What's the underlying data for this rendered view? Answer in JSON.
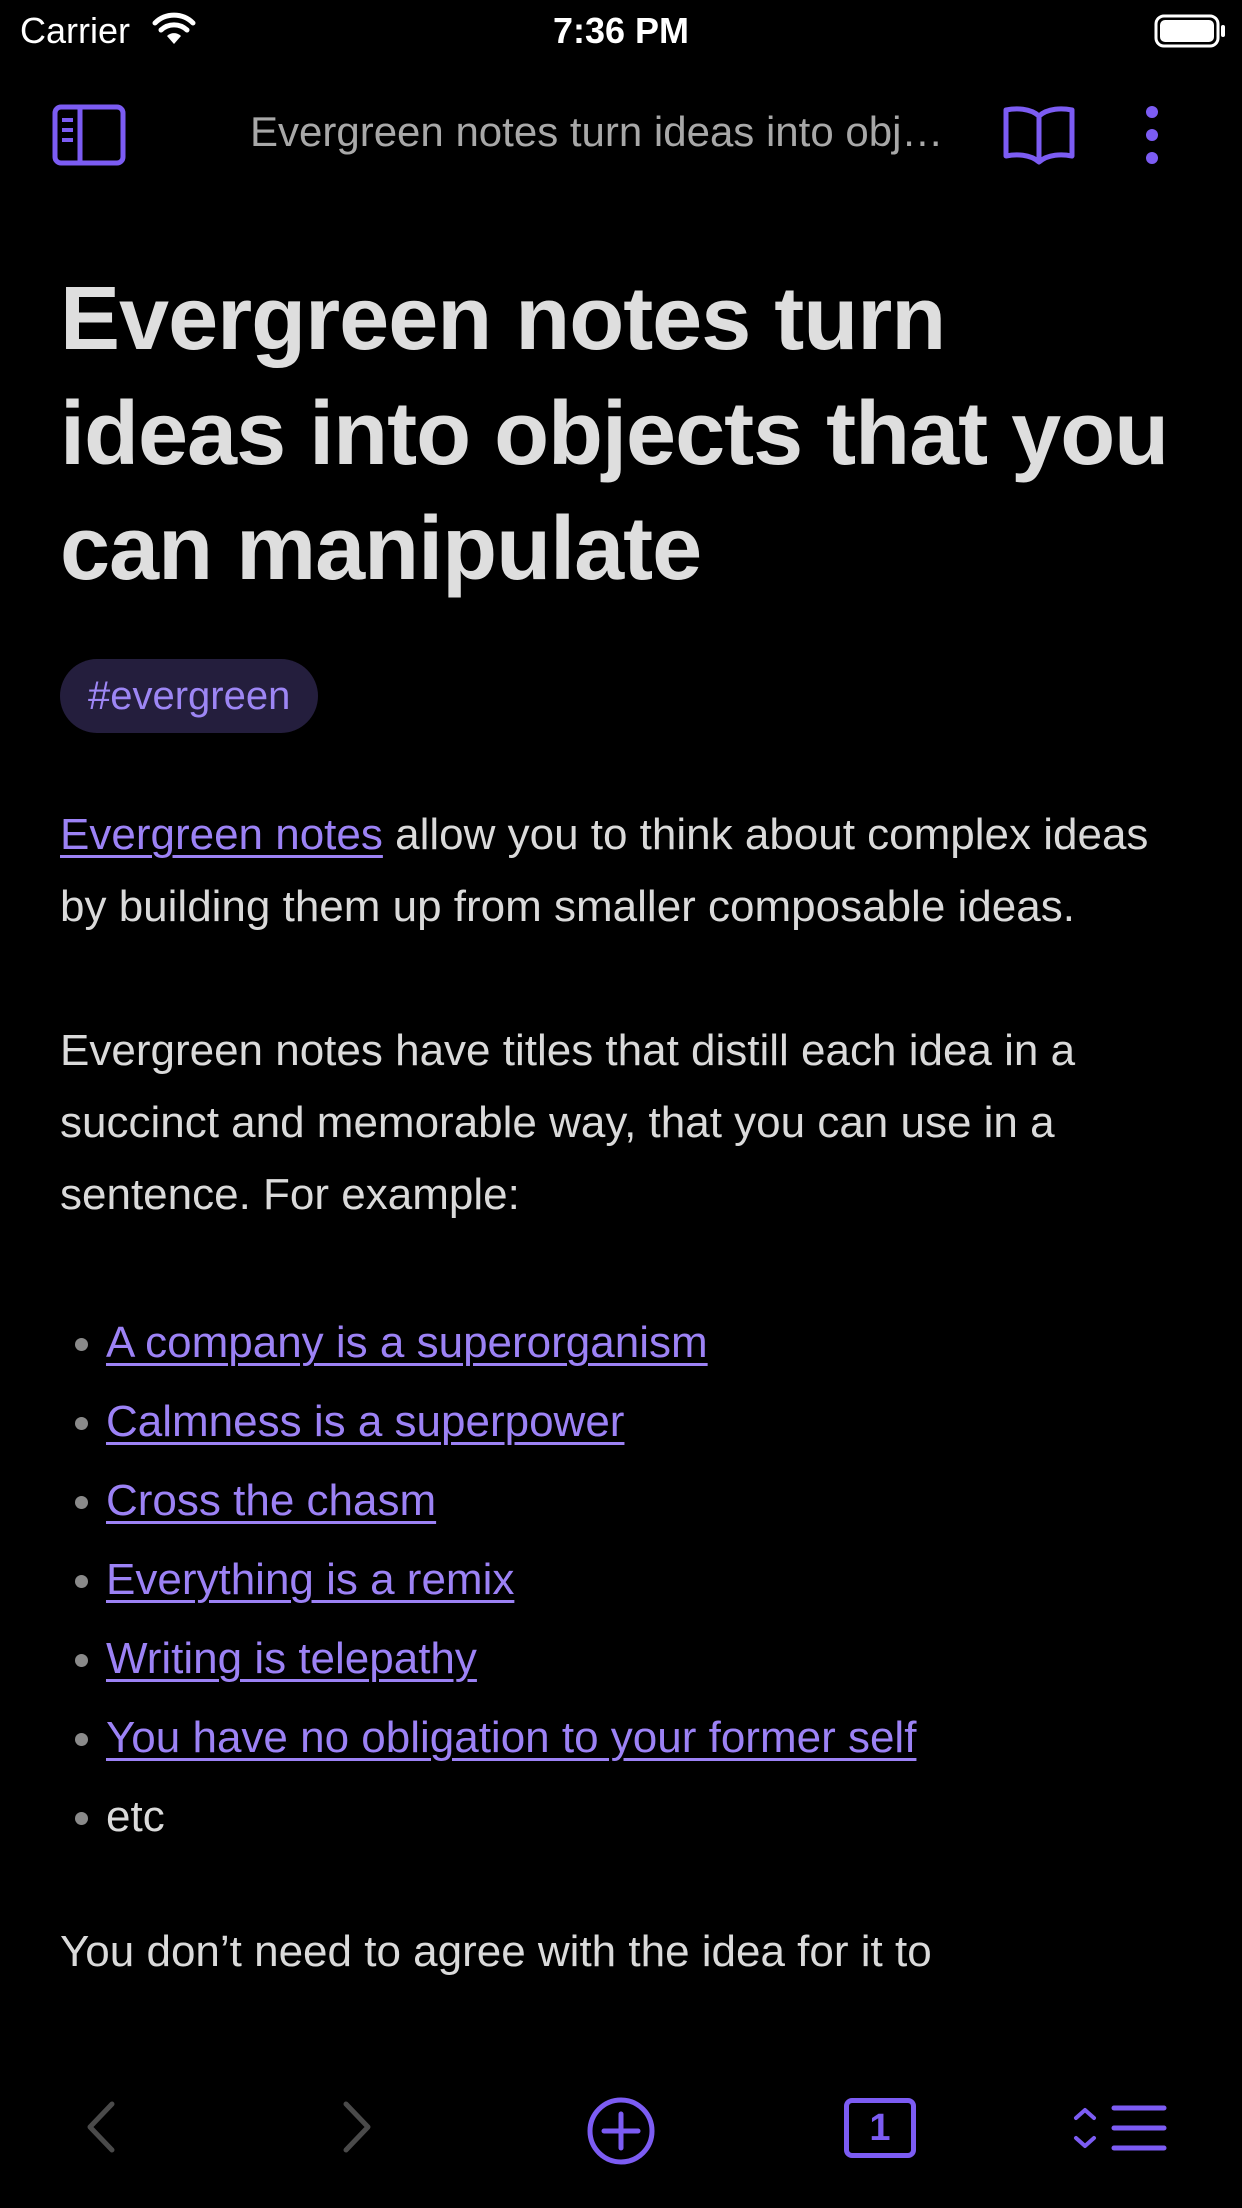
{
  "status_bar": {
    "carrier": "Carrier",
    "time": "7:36 PM"
  },
  "header": {
    "title": "Evergreen notes turn ideas into objects that you can manipulate"
  },
  "note": {
    "title": "Evergreen notes turn ideas into objects that you can manipulate",
    "tag": "#evergreen",
    "para1_link": "Evergreen notes",
    "para1_text": " allow you to think about complex ideas by building them up from smaller composable ideas.",
    "para2": "Evergreen notes have titles that distill each idea in a succinct and memorable way, that you can use in a sentence. For example:",
    "examples": [
      "A company is a superorganism",
      "Calmness is a superpower",
      "Cross the chasm",
      "Everything is a remix",
      "Writing is telepathy",
      "You have no obligation to your former self"
    ],
    "examples_tail": "etc",
    "para3": "You don’t need to agree with the idea for it to"
  },
  "bottom_bar": {
    "tab_count": "1"
  },
  "colors": {
    "accent": "#7c5cf3",
    "link": "#9c82f5",
    "background": "#000000",
    "tag_background": "#241e3d"
  },
  "icons": [
    "wifi-icon",
    "battery-icon",
    "sidebar-toggle-icon",
    "book-icon",
    "more-vertical-icon",
    "back-chevron-icon",
    "forward-chevron-icon",
    "plus-circle-icon",
    "menu-icon"
  ]
}
